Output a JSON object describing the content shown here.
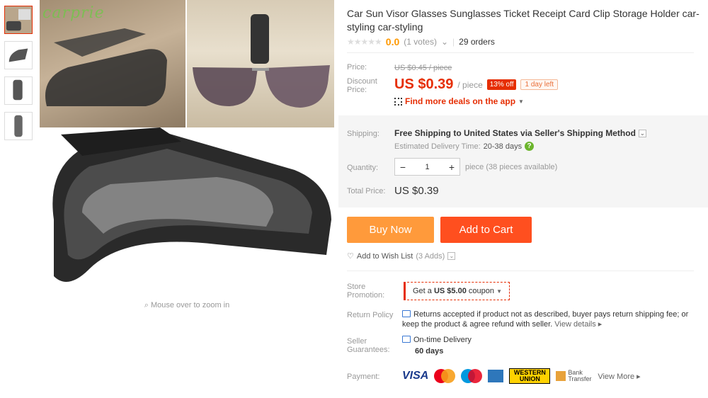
{
  "product": {
    "title": "Car Sun Visor Glasses Sunglasses Ticket Receipt Card Clip Storage Holder car-styling car-styling",
    "rating_score": "0.0",
    "rating_votes": "(1 votes)",
    "orders": "29 orders",
    "watermark": "carprie"
  },
  "labels": {
    "price": "Price:",
    "discount_price": "Discount Price:",
    "shipping": "Shipping:",
    "quantity": "Quantity:",
    "total_price": "Total Price:",
    "store_promotion": "Store Promotion:",
    "return_policy": "Return Policy",
    "seller_guarantees": "Seller Guarantees:",
    "payment": "Payment:"
  },
  "pricing": {
    "original": "US $0.45 / piece",
    "current": "US $0.39",
    "unit": "/ piece",
    "discount_badge": "13% off",
    "time_left": "1 day left",
    "deals_link": "Find more deals on the app"
  },
  "shipping": {
    "main": "Free Shipping to United States via Seller's Shipping Method",
    "estimate_label": "Estimated Delivery Time:",
    "estimate_value": "20-38 days"
  },
  "quantity": {
    "value": "1",
    "minus": "−",
    "plus": "+",
    "note": "piece (38 pieces available)"
  },
  "total": "US $0.39",
  "buttons": {
    "buy_now": "Buy Now",
    "add_to_cart": "Add to Cart"
  },
  "wishlist": {
    "label": "Add to Wish List",
    "count": "(3 Adds)"
  },
  "promotion": {
    "prefix": "Get a",
    "amount": "US $5.00",
    "suffix": "coupon"
  },
  "return_policy": {
    "text": "Returns accepted if product not as described, buyer pays return shipping fee; or keep the product & agree refund with seller.",
    "link": "View details"
  },
  "guarantee": {
    "label": "On-time Delivery",
    "days": "60 days"
  },
  "payment": {
    "visa": "VISA",
    "western_union": "WESTERN UNION",
    "bank": "Bank Transfer",
    "view_more": "View More"
  },
  "zoom_hint": "Mouse over to zoom in",
  "colors": {
    "accent": "#e62e04",
    "buy_now": "#ff9a3b",
    "add_to_cart": "#ff4f1f",
    "rating": "#ff9900"
  }
}
